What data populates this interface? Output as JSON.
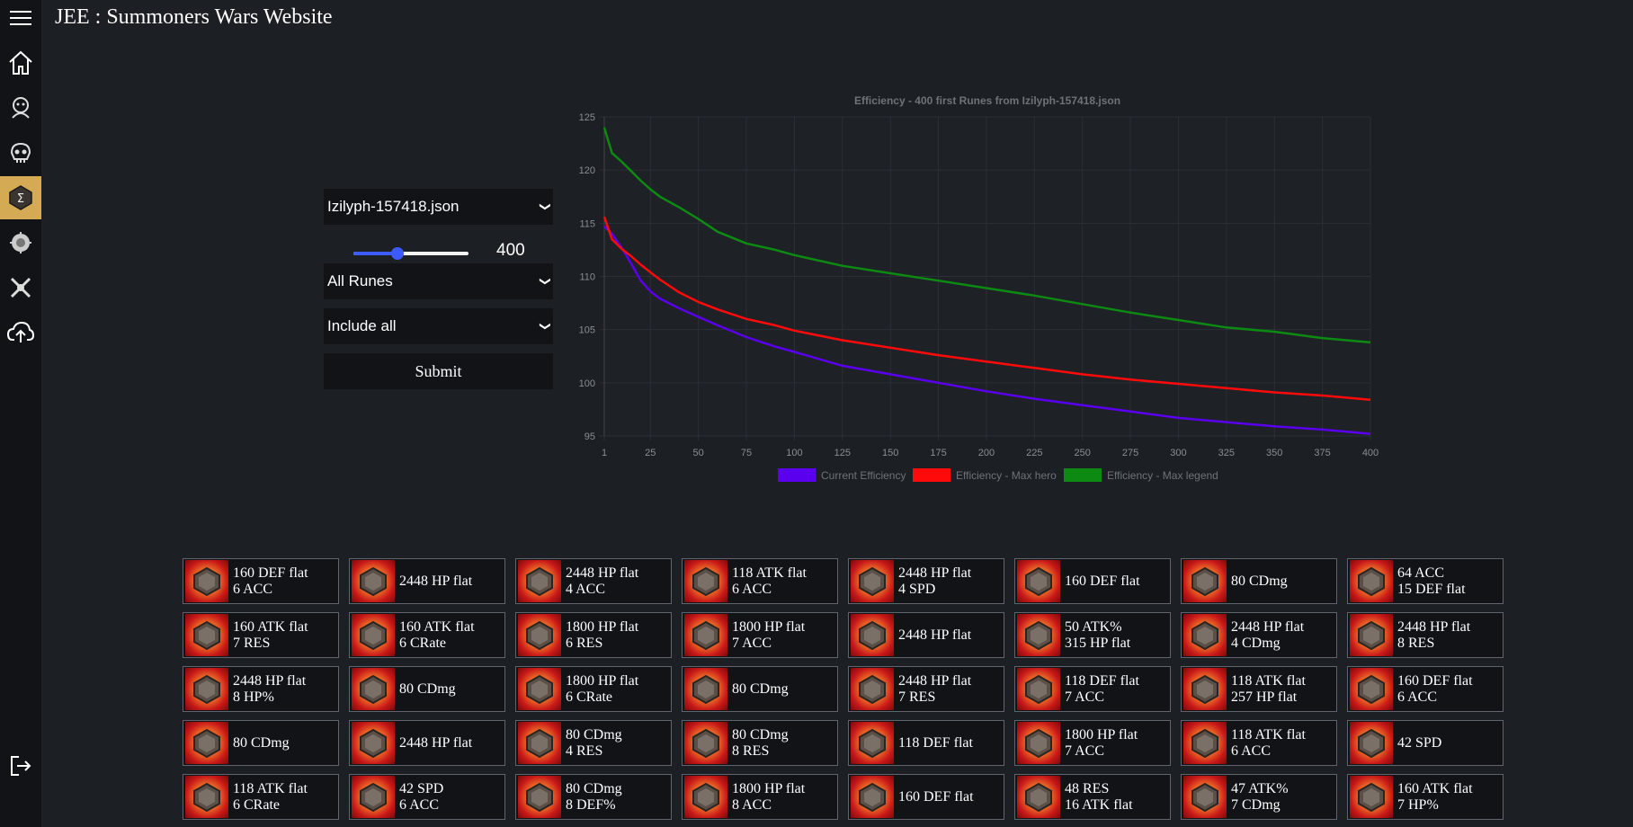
{
  "app": {
    "title": "JEE : Summoners Wars Website"
  },
  "sidebar": {
    "items": [
      {
        "icon": "menu-icon"
      },
      {
        "icon": "home-icon"
      },
      {
        "icon": "monster-icon"
      },
      {
        "icon": "skull-icon"
      },
      {
        "icon": "rune-icon",
        "active": true
      },
      {
        "icon": "artifact-icon"
      },
      {
        "icon": "battle-icon"
      },
      {
        "icon": "cloud-upload-icon"
      },
      {
        "icon": "logout-icon"
      }
    ]
  },
  "form": {
    "file_select": "Izilyph-157418.json",
    "slider_value": "400",
    "slider_fraction": 0.38,
    "rune_filter": "All Runes",
    "include_filter": "Include all",
    "submit_label": "Submit"
  },
  "chart_data": {
    "type": "line",
    "title": "Efficiency - 400 first Runes from Izilyph-157418.json",
    "xlim": [
      1,
      400
    ],
    "ylim": [
      95,
      125
    ],
    "x_ticks": [
      "1",
      "25",
      "50",
      "75",
      "100",
      "125",
      "150",
      "175",
      "200",
      "225",
      "250",
      "275",
      "300",
      "325",
      "350",
      "375",
      "400"
    ],
    "y_ticks": [
      "95",
      "100",
      "105",
      "110",
      "115",
      "120",
      "125"
    ],
    "legend_position": "bottom",
    "grid": true,
    "series": [
      {
        "name": "Current Efficiency",
        "color": "#5a00ee",
        "x": [
          1,
          5,
          10,
          15,
          20,
          25,
          30,
          40,
          50,
          60,
          75,
          90,
          100,
          125,
          150,
          175,
          200,
          225,
          250,
          275,
          300,
          325,
          350,
          375,
          400
        ],
        "y": [
          114.7,
          114.0,
          112.7,
          111.2,
          109.6,
          108.6,
          107.9,
          107.0,
          106.2,
          105.4,
          104.3,
          103.4,
          102.9,
          101.6,
          100.8,
          100.0,
          99.2,
          98.5,
          97.9,
          97.3,
          96.7,
          96.3,
          95.9,
          95.6,
          95.2
        ]
      },
      {
        "name": "Efficiency - Max hero",
        "color": "#ff0a0a",
        "x": [
          1,
          5,
          10,
          15,
          20,
          25,
          30,
          40,
          50,
          60,
          75,
          90,
          100,
          125,
          150,
          175,
          200,
          225,
          250,
          275,
          300,
          325,
          350,
          375,
          400
        ],
        "y": [
          115.6,
          113.5,
          112.6,
          111.9,
          111.1,
          110.4,
          109.7,
          108.5,
          107.6,
          106.9,
          106.0,
          105.4,
          104.9,
          104.0,
          103.3,
          102.6,
          102.0,
          101.4,
          100.8,
          100.3,
          99.9,
          99.5,
          99.1,
          98.8,
          98.4
        ]
      },
      {
        "name": "Efficiency - Max legend",
        "color": "#0d8a12",
        "x": [
          1,
          5,
          10,
          15,
          20,
          25,
          30,
          40,
          50,
          60,
          75,
          90,
          100,
          125,
          150,
          175,
          200,
          225,
          250,
          275,
          300,
          325,
          350,
          375,
          400
        ],
        "y": [
          124.0,
          121.6,
          120.8,
          119.9,
          119.0,
          118.2,
          117.5,
          116.5,
          115.4,
          114.2,
          113.1,
          112.5,
          112.0,
          111.0,
          110.3,
          109.6,
          108.9,
          108.2,
          107.4,
          106.6,
          105.9,
          105.2,
          104.8,
          104.2,
          103.8
        ]
      }
    ]
  },
  "runes": [
    {
      "lines": [
        "160 DEF flat",
        "6 ACC"
      ],
      "set_icon": "violent-set-icon"
    },
    {
      "lines": [
        "2448 HP flat"
      ],
      "set_icon": "swift-set-icon"
    },
    {
      "lines": [
        "2448 HP flat",
        "4 ACC"
      ],
      "set_icon": "despair-set-icon"
    },
    {
      "lines": [
        "118 ATK flat",
        "6 ACC"
      ],
      "set_icon": "focus-set-icon"
    },
    {
      "lines": [
        "2448 HP flat",
        "4 SPD"
      ],
      "set_icon": "despair-set-icon"
    },
    {
      "lines": [
        "160 DEF flat"
      ],
      "set_icon": "guard-set-icon"
    },
    {
      "lines": [
        "80 CDmg"
      ],
      "set_icon": "rage-set-icon"
    },
    {
      "lines": [
        "64 ACC",
        "15 DEF flat"
      ],
      "set_icon": "energy-set-icon"
    },
    {
      "lines": [
        "160 ATK flat",
        "7 RES"
      ],
      "set_icon": "violent-set-icon"
    },
    {
      "lines": [
        "160 ATK flat",
        "6 CRate"
      ],
      "set_icon": "blade-set-icon"
    },
    {
      "lines": [
        "1800 HP flat",
        "6 RES"
      ],
      "set_icon": "fight-set-icon"
    },
    {
      "lines": [
        "1800 HP flat",
        "7 ACC"
      ],
      "set_icon": "violent-set-icon"
    },
    {
      "lines": [
        "2448 HP flat"
      ],
      "set_icon": "focus-set-icon"
    },
    {
      "lines": [
        "50 ATK%",
        "315 HP flat"
      ],
      "set_icon": "swift-set-icon"
    },
    {
      "lines": [
        "2448 HP flat",
        "4 CDmg"
      ],
      "set_icon": "blade-set-icon"
    },
    {
      "lines": [
        "2448 HP flat",
        "8 RES"
      ],
      "set_icon": "despair-set-icon"
    },
    {
      "lines": [
        "2448 HP flat",
        "8 HP%"
      ],
      "set_icon": "blade-set-icon"
    },
    {
      "lines": [
        "80 CDmg"
      ],
      "set_icon": "fatal-set-icon"
    },
    {
      "lines": [
        "1800 HP flat",
        "6 CRate"
      ],
      "set_icon": "violent-set-icon"
    },
    {
      "lines": [
        "80 CDmg"
      ],
      "set_icon": "fatal-set-icon"
    },
    {
      "lines": [
        "2448 HP flat",
        "7 RES"
      ],
      "set_icon": "violent-set-icon"
    },
    {
      "lines": [
        "118 DEF flat",
        "7 ACC"
      ],
      "set_icon": "swift-set-icon"
    },
    {
      "lines": [
        "118 ATK flat",
        "257 HP flat"
      ],
      "set_icon": "energy-set-icon"
    },
    {
      "lines": [
        "160 DEF flat",
        "6 ACC"
      ],
      "set_icon": "rage-set-icon"
    },
    {
      "lines": [
        "80 CDmg"
      ],
      "set_icon": "violent-set-icon"
    },
    {
      "lines": [
        "2448 HP flat"
      ],
      "set_icon": "energy-set-icon"
    },
    {
      "lines": [
        "80 CDmg",
        "4 RES"
      ],
      "set_icon": "shield-set-icon"
    },
    {
      "lines": [
        "80 CDmg",
        "8 RES"
      ],
      "set_icon": "rage-set-icon"
    },
    {
      "lines": [
        "118 DEF flat"
      ],
      "set_icon": "nemesis-set-icon"
    },
    {
      "lines": [
        "1800 HP flat",
        "7 ACC"
      ],
      "set_icon": "focus-set-icon"
    },
    {
      "lines": [
        "118 ATK flat",
        "6 ACC"
      ],
      "set_icon": "despair-set-icon"
    },
    {
      "lines": [
        "42 SPD"
      ],
      "set_icon": "rage-set-icon"
    },
    {
      "lines": [
        "118 ATK flat",
        "6 CRate"
      ],
      "set_icon": "swift-set-icon"
    },
    {
      "lines": [
        "42 SPD",
        "6 ACC"
      ],
      "set_icon": "swift-set-icon"
    },
    {
      "lines": [
        "80 CDmg",
        "8 DEF%"
      ],
      "set_icon": "focus-set-icon"
    },
    {
      "lines": [
        "1800 HP flat",
        "8 ACC"
      ],
      "set_icon": "will-set-icon"
    },
    {
      "lines": [
        "160 DEF flat"
      ],
      "set_icon": "fatal-set-icon"
    },
    {
      "lines": [
        "48 RES",
        "16 ATK flat"
      ],
      "set_icon": "swift-set-icon"
    },
    {
      "lines": [
        "47 ATK%",
        "7 CDmg"
      ],
      "set_icon": "focus-set-icon"
    },
    {
      "lines": [
        "160 ATK flat",
        "7 HP%"
      ],
      "set_icon": "swift-set-icon"
    }
  ]
}
